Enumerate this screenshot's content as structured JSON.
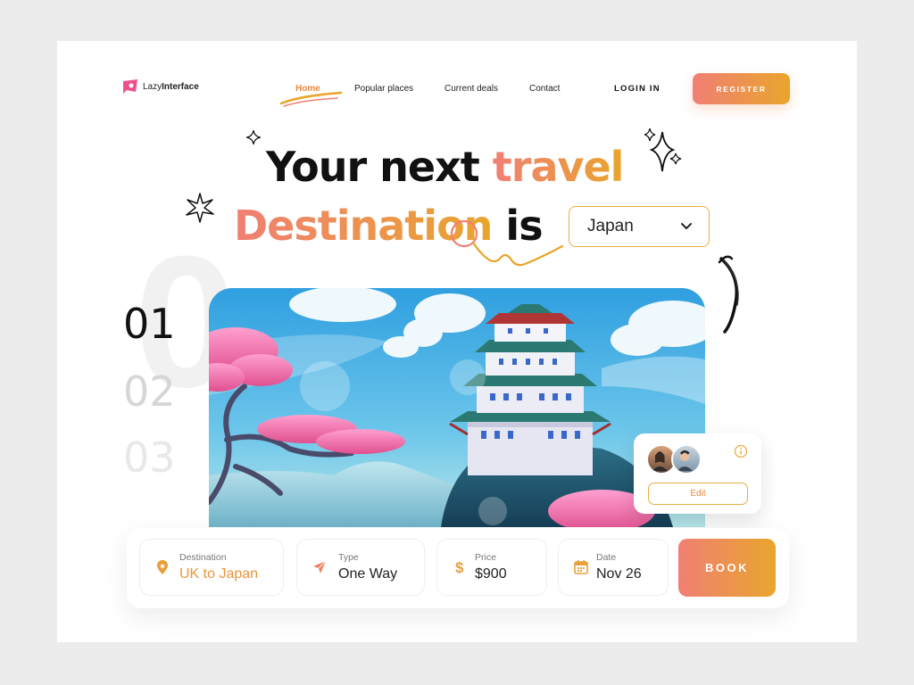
{
  "brand": {
    "name_light": "Lazy",
    "name_bold": "Interface"
  },
  "nav": {
    "items": [
      "Home",
      "Popular places",
      "Current deals",
      "Contact"
    ],
    "active": "Home",
    "login": "LOGIN IN",
    "register": "REGISTER"
  },
  "hero": {
    "line1_dark": "Your next ",
    "line1_accent": "travel",
    "line2_accent": "Destination",
    "line2_dark": " is",
    "destination_select": "Japan"
  },
  "slides": {
    "numbers": [
      "01",
      "02",
      "03"
    ],
    "active": "01"
  },
  "travelers_card": {
    "edit": "Edit"
  },
  "booking": {
    "destination_label": "Destination",
    "destination_value": "UK to Japan",
    "type_label": "Type",
    "type_value": "One Way",
    "price_label": "Price",
    "price_value": "$900",
    "date_label": "Date",
    "date_value": "Nov 26",
    "book": "BOOK"
  },
  "colors": {
    "accent_start": "#f07f74",
    "accent_end": "#e9a52c",
    "background": "#ececec"
  },
  "icons": [
    "logo-icon",
    "chevron-down-icon",
    "sparkle-icon",
    "location-pin-icon",
    "send-icon",
    "dollar-icon",
    "calendar-icon",
    "info-icon"
  ]
}
